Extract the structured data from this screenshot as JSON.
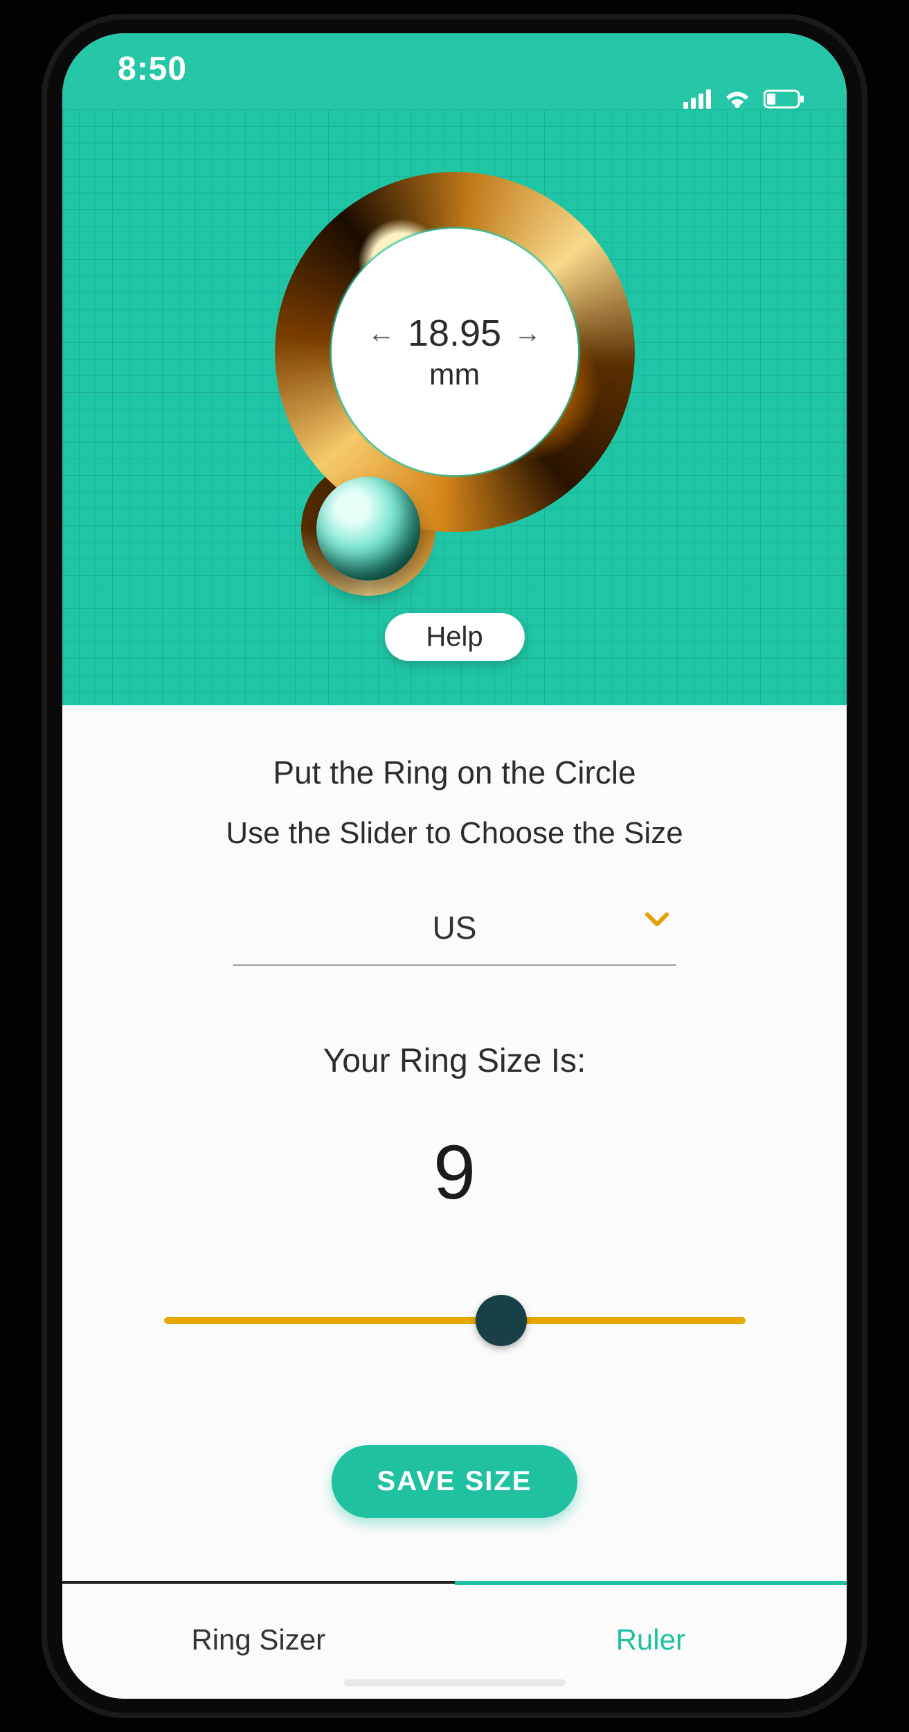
{
  "status": {
    "time": "8:50",
    "signal_icon": "cellular-signal-icon",
    "wifi_icon": "wifi-icon",
    "battery_icon": "battery-low-icon"
  },
  "sizer": {
    "diameter_value": "18.95",
    "diameter_unit": "mm",
    "help_label": "Help"
  },
  "panel": {
    "instruction_1": "Put the Ring on the Circle",
    "instruction_2": "Use the Slider to Choose the Size",
    "region_label": "US",
    "your_size_label": "Your Ring Size Is:",
    "ring_size_value": "9",
    "slider_percent": 58,
    "save_label": "SAVE SIZE"
  },
  "tabs": {
    "ring_sizer": "Ring Sizer",
    "ruler": "Ruler",
    "active": "ruler"
  },
  "colors": {
    "accent_teal": "#1fc6a6",
    "accent_yellow": "#e7a900"
  }
}
